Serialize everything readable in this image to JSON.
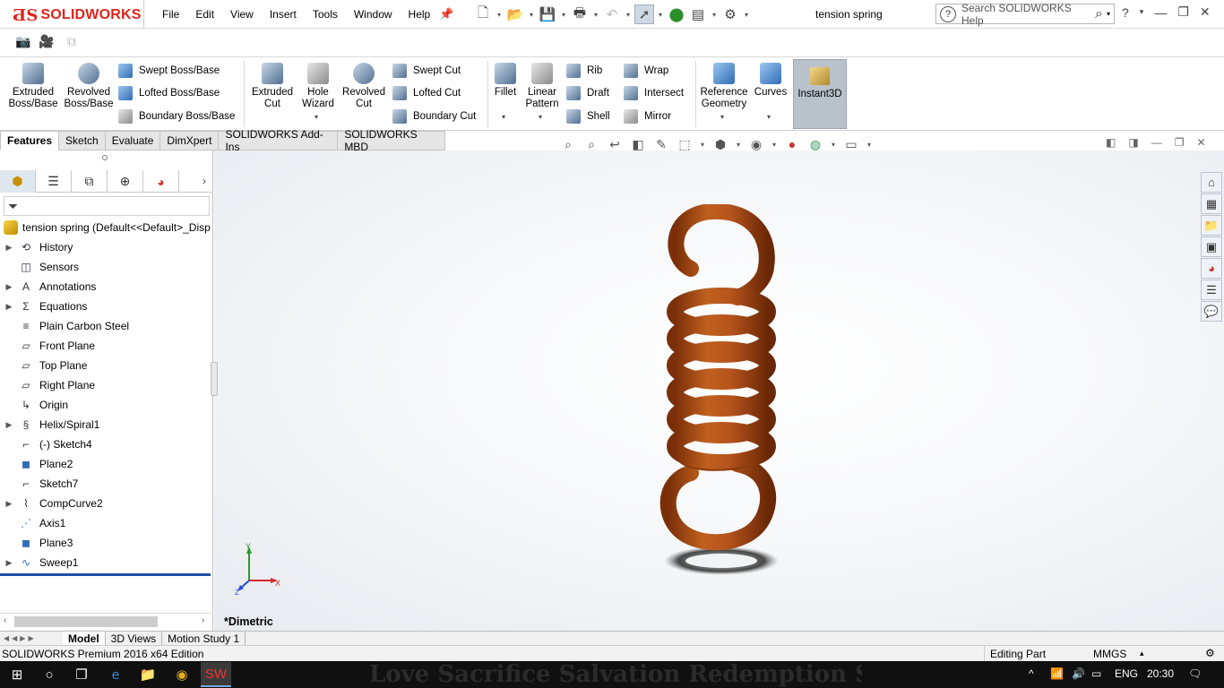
{
  "app": {
    "logo_text": "SOLIDWORKS",
    "document_title": "tension spring"
  },
  "menu": [
    "File",
    "Edit",
    "View",
    "Insert",
    "Tools",
    "Window",
    "Help"
  ],
  "search": {
    "placeholder": "Search SOLIDWORKS Help"
  },
  "ribbon": {
    "extruded_boss": "Extruded Boss/Base",
    "revolved_boss": "Revolved Boss/Base",
    "swept_boss": "Swept Boss/Base",
    "lofted_boss": "Lofted Boss/Base",
    "boundary_boss": "Boundary Boss/Base",
    "extruded_cut": "Extruded Cut",
    "hole_wizard": "Hole Wizard",
    "revolved_cut": "Revolved Cut",
    "swept_cut": "Swept Cut",
    "lofted_cut": "Lofted Cut",
    "boundary_cut": "Boundary Cut",
    "fillet": "Fillet",
    "linear_pattern": "Linear Pattern",
    "rib": "Rib",
    "draft": "Draft",
    "shell": "Shell",
    "wrap": "Wrap",
    "intersect": "Intersect",
    "mirror": "Mirror",
    "reference_geometry": "Reference Geometry",
    "curves": "Curves",
    "instant3d": "Instant3D"
  },
  "command_tabs": [
    "Features",
    "Sketch",
    "Evaluate",
    "DimXpert",
    "SOLIDWORKS Add-Ins",
    "SOLIDWORKS MBD"
  ],
  "feature_tree": {
    "root": "tension spring  (Default<<Default>_Disp",
    "items": [
      {
        "label": "History",
        "expandable": true,
        "icon": "history-icon"
      },
      {
        "label": "Sensors",
        "expandable": false,
        "icon": "sensors-icon"
      },
      {
        "label": "Annotations",
        "expandable": true,
        "icon": "annotations-icon"
      },
      {
        "label": "Equations",
        "expandable": true,
        "icon": "equations-icon"
      },
      {
        "label": "Plain Carbon Steel",
        "expandable": false,
        "icon": "material-icon"
      },
      {
        "label": "Front Plane",
        "expandable": false,
        "icon": "plane-icon"
      },
      {
        "label": "Top Plane",
        "expandable": false,
        "icon": "plane-icon"
      },
      {
        "label": "Right Plane",
        "expandable": false,
        "icon": "plane-icon"
      },
      {
        "label": "Origin",
        "expandable": false,
        "icon": "origin-icon"
      },
      {
        "label": "Helix/Spiral1",
        "expandable": true,
        "icon": "helix-icon"
      },
      {
        "label": "(-) Sketch4",
        "expandable": false,
        "icon": "sketch-icon"
      },
      {
        "label": "Plane2",
        "expandable": false,
        "icon": "plane-solid-icon"
      },
      {
        "label": "Sketch7",
        "expandable": false,
        "icon": "sketch-icon"
      },
      {
        "label": "CompCurve2",
        "expandable": true,
        "icon": "composite-curve-icon"
      },
      {
        "label": "Axis1",
        "expandable": false,
        "icon": "axis-icon"
      },
      {
        "label": "Plane3",
        "expandable": false,
        "icon": "plane-solid-icon"
      },
      {
        "label": "Sweep1",
        "expandable": true,
        "icon": "sweep-icon"
      }
    ]
  },
  "viewport": {
    "view_orientation": "*Dimetric",
    "triad": {
      "x": "X",
      "y": "Y",
      "z": "Z"
    },
    "model_color": "#b5531c"
  },
  "bottom_tabs": [
    "Model",
    "3D Views",
    "Motion Study 1"
  ],
  "status": {
    "edition": "SOLIDWORKS Premium 2016 x64 Edition",
    "mode": "Editing Part",
    "units": "MMGS"
  },
  "taskbar": {
    "language": "ENG",
    "time": "20:30",
    "wallpaper_text": "Love  Sacrifice  Salvation  Redemption  Sacrifice"
  }
}
